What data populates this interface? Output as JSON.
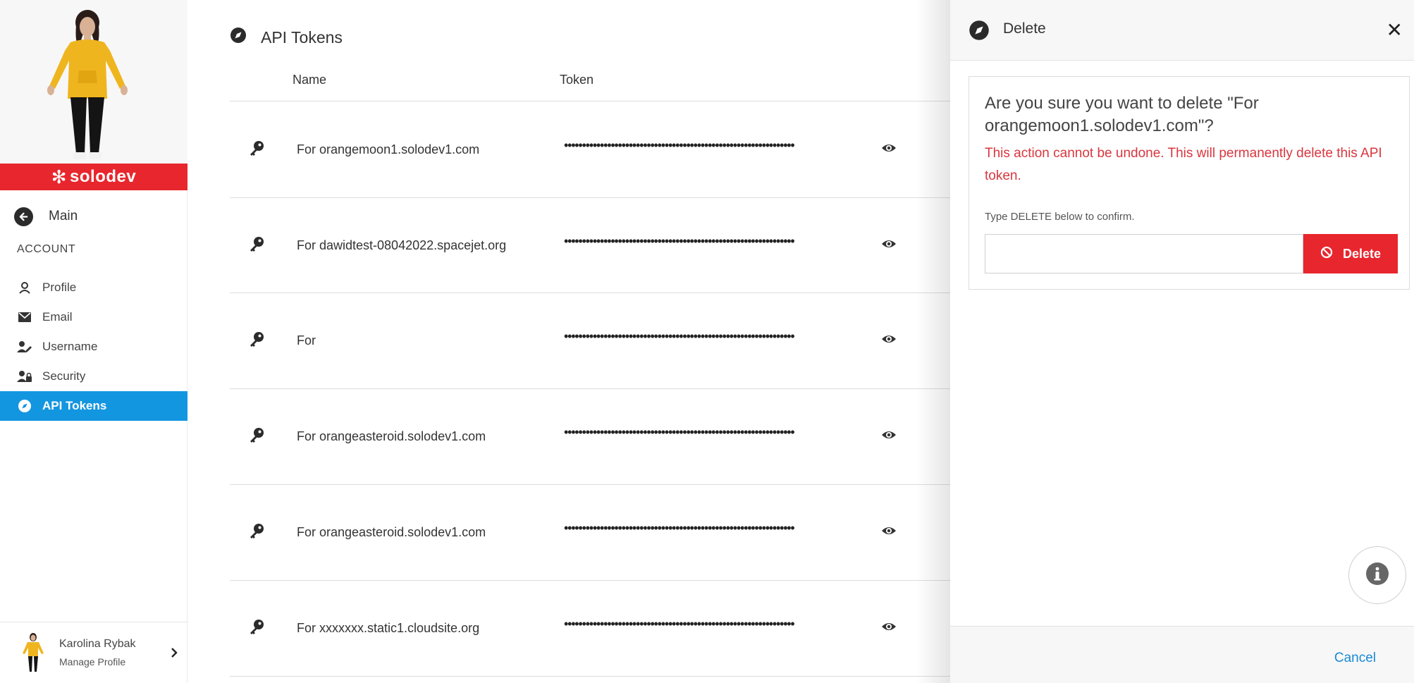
{
  "sidebar": {
    "brand": "solodev",
    "main_label": "Main",
    "section_label": "ACCOUNT",
    "items": [
      {
        "label": "Profile",
        "icon": "user-icon"
      },
      {
        "label": "Email",
        "icon": "envelope-icon"
      },
      {
        "label": "Username",
        "icon": "user-edit-icon"
      },
      {
        "label": "Security",
        "icon": "user-lock-icon"
      },
      {
        "label": "API Tokens",
        "icon": "compass-icon",
        "active": true
      }
    ],
    "footer": {
      "name": "Karolina Rybak",
      "sub": "Manage Profile"
    }
  },
  "main": {
    "title": "API Tokens",
    "columns": {
      "name": "Name",
      "token": "Token"
    },
    "rows": [
      {
        "name": "For orangemoon1.solodev1.com",
        "token": "••••••••••••••••••••••••••••••••••••••••••••••••••••••••••••••••"
      },
      {
        "name": "For dawidtest-08042022.spacejet.org",
        "token": "••••••••••••••••••••••••••••••••••••••••••••••••••••••••••••••••"
      },
      {
        "name": "For",
        "token": "••••••••••••••••••••••••••••••••••••••••••••••••••••••••••••••••"
      },
      {
        "name": "For orangeasteroid.solodev1.com",
        "token": "••••••••••••••••••••••••••••••••••••••••••••••••••••••••••••••••"
      },
      {
        "name": "For orangeasteroid.solodev1.com",
        "token": "••••••••••••••••••••••••••••••••••••••••••••••••••••••••••••••••"
      },
      {
        "name": "For xxxxxxx.static1.cloudsite.org",
        "token": "••••••••••••••••••••••••••••••••••••••••••••••••••••••••••••••••"
      }
    ]
  },
  "panel": {
    "title": "Delete",
    "close": "✕",
    "question": "Are you sure you want to delete \"For orangemoon1.solodev1.com\"?",
    "warning": "This action cannot be undone. This will permanently delete this API token.",
    "instruction": "Type DELETE below to confirm.",
    "input_value": "",
    "delete_label": "Delete",
    "cancel_label": "Cancel"
  },
  "colors": {
    "brand": "#e8262d",
    "active": "#1396e0",
    "danger": "#d9363e",
    "link": "#1a8ad4"
  }
}
